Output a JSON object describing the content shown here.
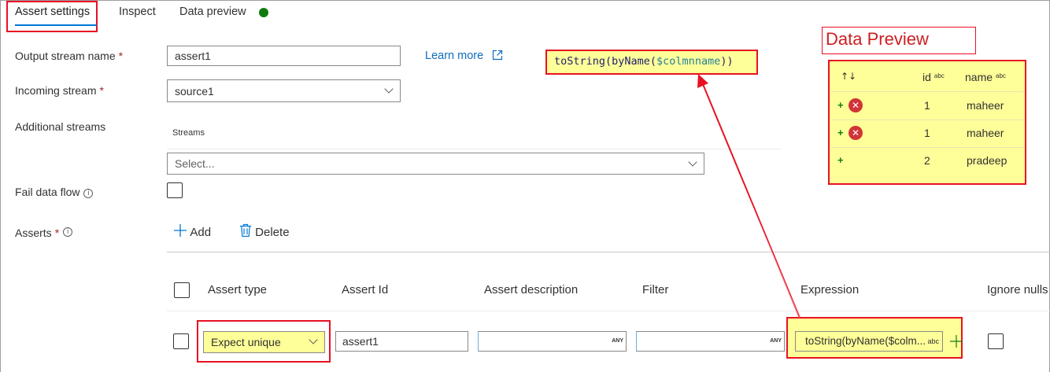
{
  "tabs": [
    {
      "label": "Assert settings"
    },
    {
      "label": "Inspect"
    },
    {
      "label": "Data preview"
    }
  ],
  "form": {
    "output_stream_label": "Output stream name",
    "output_stream_value": "assert1",
    "incoming_stream_label": "Incoming stream",
    "incoming_stream_value": "source1",
    "additional_streams_label": "Additional streams",
    "streams_header": "Streams",
    "streams_placeholder": "Select...",
    "fail_data_flow_label": "Fail data flow",
    "asserts_label": "Asserts",
    "required_mark": "*",
    "learn_more": "Learn more"
  },
  "annotation": {
    "code_prefix": "toString(byName(",
    "code_var": "$colmnname",
    "code_suffix": "))",
    "data_preview_title": "Data Preview"
  },
  "preview": {
    "headers": {
      "sort": "↑↓",
      "id": "id",
      "name": "name",
      "type_tag": "abc"
    },
    "rows": [
      {
        "id": "1",
        "name": "maheer",
        "error": true
      },
      {
        "id": "1",
        "name": "maheer",
        "error": true
      },
      {
        "id": "2",
        "name": "pradeep",
        "error": false
      }
    ]
  },
  "toolbar": {
    "add_label": "Add",
    "delete_label": "Delete"
  },
  "table": {
    "columns": [
      "Assert type",
      "Assert Id",
      "Assert description",
      "Filter",
      "Expression",
      "Ignore nulls"
    ],
    "row": {
      "assert_type": "Expect unique",
      "assert_id": "assert1",
      "any_tag": "ANY",
      "expression": "toString(byName($colm...",
      "expression_tag": "abc"
    }
  },
  "colors": {
    "accent": "#0078d4",
    "highlight_border": "#e81123",
    "highlight_fill": "#ffff99",
    "status_ok": "#107c10",
    "error": "#d13438"
  }
}
